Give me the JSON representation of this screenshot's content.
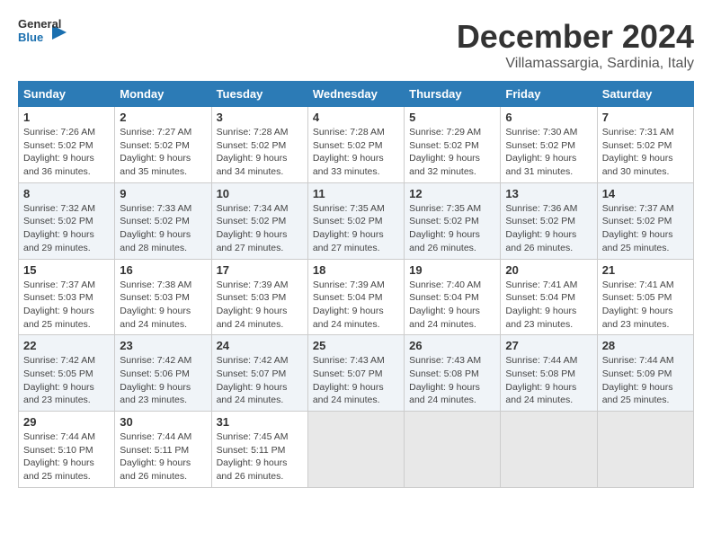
{
  "logo": {
    "text_general": "General",
    "text_blue": "Blue"
  },
  "header": {
    "month_year": "December 2024",
    "location": "Villamassargia, Sardinia, Italy"
  },
  "weekdays": [
    "Sunday",
    "Monday",
    "Tuesday",
    "Wednesday",
    "Thursday",
    "Friday",
    "Saturday"
  ],
  "weeks": [
    [
      {
        "day": "1",
        "info": "Sunrise: 7:26 AM\nSunset: 5:02 PM\nDaylight: 9 hours\nand 36 minutes."
      },
      {
        "day": "2",
        "info": "Sunrise: 7:27 AM\nSunset: 5:02 PM\nDaylight: 9 hours\nand 35 minutes."
      },
      {
        "day": "3",
        "info": "Sunrise: 7:28 AM\nSunset: 5:02 PM\nDaylight: 9 hours\nand 34 minutes."
      },
      {
        "day": "4",
        "info": "Sunrise: 7:28 AM\nSunset: 5:02 PM\nDaylight: 9 hours\nand 33 minutes."
      },
      {
        "day": "5",
        "info": "Sunrise: 7:29 AM\nSunset: 5:02 PM\nDaylight: 9 hours\nand 32 minutes."
      },
      {
        "day": "6",
        "info": "Sunrise: 7:30 AM\nSunset: 5:02 PM\nDaylight: 9 hours\nand 31 minutes."
      },
      {
        "day": "7",
        "info": "Sunrise: 7:31 AM\nSunset: 5:02 PM\nDaylight: 9 hours\nand 30 minutes."
      }
    ],
    [
      {
        "day": "8",
        "info": "Sunrise: 7:32 AM\nSunset: 5:02 PM\nDaylight: 9 hours\nand 29 minutes."
      },
      {
        "day": "9",
        "info": "Sunrise: 7:33 AM\nSunset: 5:02 PM\nDaylight: 9 hours\nand 28 minutes."
      },
      {
        "day": "10",
        "info": "Sunrise: 7:34 AM\nSunset: 5:02 PM\nDaylight: 9 hours\nand 27 minutes."
      },
      {
        "day": "11",
        "info": "Sunrise: 7:35 AM\nSunset: 5:02 PM\nDaylight: 9 hours\nand 27 minutes."
      },
      {
        "day": "12",
        "info": "Sunrise: 7:35 AM\nSunset: 5:02 PM\nDaylight: 9 hours\nand 26 minutes."
      },
      {
        "day": "13",
        "info": "Sunrise: 7:36 AM\nSunset: 5:02 PM\nDaylight: 9 hours\nand 26 minutes."
      },
      {
        "day": "14",
        "info": "Sunrise: 7:37 AM\nSunset: 5:02 PM\nDaylight: 9 hours\nand 25 minutes."
      }
    ],
    [
      {
        "day": "15",
        "info": "Sunrise: 7:37 AM\nSunset: 5:03 PM\nDaylight: 9 hours\nand 25 minutes."
      },
      {
        "day": "16",
        "info": "Sunrise: 7:38 AM\nSunset: 5:03 PM\nDaylight: 9 hours\nand 24 minutes."
      },
      {
        "day": "17",
        "info": "Sunrise: 7:39 AM\nSunset: 5:03 PM\nDaylight: 9 hours\nand 24 minutes."
      },
      {
        "day": "18",
        "info": "Sunrise: 7:39 AM\nSunset: 5:04 PM\nDaylight: 9 hours\nand 24 minutes."
      },
      {
        "day": "19",
        "info": "Sunrise: 7:40 AM\nSunset: 5:04 PM\nDaylight: 9 hours\nand 24 minutes."
      },
      {
        "day": "20",
        "info": "Sunrise: 7:41 AM\nSunset: 5:04 PM\nDaylight: 9 hours\nand 23 minutes."
      },
      {
        "day": "21",
        "info": "Sunrise: 7:41 AM\nSunset: 5:05 PM\nDaylight: 9 hours\nand 23 minutes."
      }
    ],
    [
      {
        "day": "22",
        "info": "Sunrise: 7:42 AM\nSunset: 5:05 PM\nDaylight: 9 hours\nand 23 minutes."
      },
      {
        "day": "23",
        "info": "Sunrise: 7:42 AM\nSunset: 5:06 PM\nDaylight: 9 hours\nand 23 minutes."
      },
      {
        "day": "24",
        "info": "Sunrise: 7:42 AM\nSunset: 5:07 PM\nDaylight: 9 hours\nand 24 minutes."
      },
      {
        "day": "25",
        "info": "Sunrise: 7:43 AM\nSunset: 5:07 PM\nDaylight: 9 hours\nand 24 minutes."
      },
      {
        "day": "26",
        "info": "Sunrise: 7:43 AM\nSunset: 5:08 PM\nDaylight: 9 hours\nand 24 minutes."
      },
      {
        "day": "27",
        "info": "Sunrise: 7:44 AM\nSunset: 5:08 PM\nDaylight: 9 hours\nand 24 minutes."
      },
      {
        "day": "28",
        "info": "Sunrise: 7:44 AM\nSunset: 5:09 PM\nDaylight: 9 hours\nand 25 minutes."
      }
    ],
    [
      {
        "day": "29",
        "info": "Sunrise: 7:44 AM\nSunset: 5:10 PM\nDaylight: 9 hours\nand 25 minutes."
      },
      {
        "day": "30",
        "info": "Sunrise: 7:44 AM\nSunset: 5:11 PM\nDaylight: 9 hours\nand 26 minutes."
      },
      {
        "day": "31",
        "info": "Sunrise: 7:45 AM\nSunset: 5:11 PM\nDaylight: 9 hours\nand 26 minutes."
      },
      null,
      null,
      null,
      null
    ]
  ]
}
